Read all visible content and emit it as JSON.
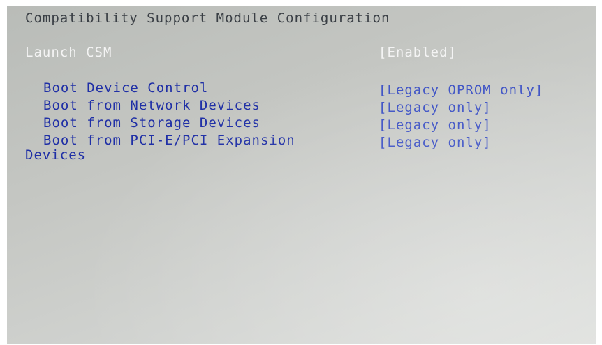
{
  "screen": {
    "title": "Compatibility Support Module Configuration"
  },
  "settings": [
    {
      "label": "Launch CSM",
      "value": "[Enabled]"
    },
    {
      "label": "Boot Device Control",
      "value": "[Legacy OPROM only]"
    },
    {
      "label": "Boot from Network Devices",
      "value": "[Legacy only]"
    },
    {
      "label": "Boot from Storage Devices",
      "value": "[Legacy only]"
    },
    {
      "label": "Boot from PCI-E/PCI Expansion",
      "label_continued": "Devices",
      "value": "[Legacy only]"
    }
  ],
  "colors": {
    "background": "#c4c6c2",
    "title": "#3a3f45",
    "label": "#1f2fa6",
    "value": "#3a4fc4",
    "highlight": "#f4f4f4"
  }
}
